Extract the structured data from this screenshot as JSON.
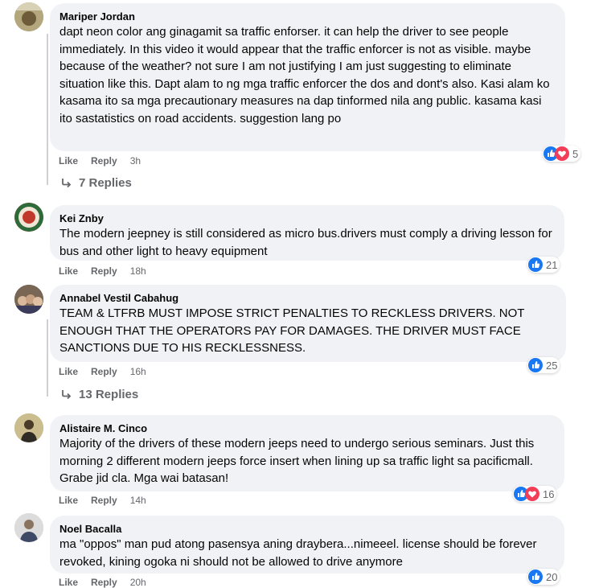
{
  "comments": [
    {
      "author": "Mariper Jordan",
      "text": "dapt neon color ang ginagamit sa traffic enforser. it can help the driver to see people immediately. In this video it would appear that the traffic enforcer is not as visible. maybe because of the weather? not sure I am not justifying I am just suggesting to eliminate situation like this. Dapt alam to ng mga traffic enforcer the dos and dont's also. Kasi alam ko kasama ito sa mga precautionary measures na dap tinformed nila ang public. kasama kasi ito sastatistics on road accidents. suggestion lang po",
      "like_label": "Like",
      "reply_label": "Reply",
      "time": "3h",
      "reaction_count": "5",
      "reactions": [
        "like-reaction-icon",
        "love-reaction-icon"
      ],
      "replies_label": "7 Replies"
    },
    {
      "author": "Kei Znby",
      "text": "The modern jeepney is still considered as micro bus.drivers must comply a driving lesson for bus and other light to heavy equipment",
      "like_label": "Like",
      "reply_label": "Reply",
      "time": "18h",
      "reaction_count": "21",
      "reactions": [
        "like-reaction-icon"
      ]
    },
    {
      "author": "Annabel Vestil Cabahug",
      "text": "TEAM & LTFRB MUST IMPOSE STRICT PENALTIES TO RECKLESS DRIVERS. NOT ENOUGH THAT THE OPERATORS PAY FOR DAMAGES. THE DRIVER MUST FACE SANCTIONS DUE TO HIS RECKLESSNESS.",
      "like_label": "Like",
      "reply_label": "Reply",
      "time": "16h",
      "reaction_count": "25",
      "reactions": [
        "like-reaction-icon"
      ],
      "replies_label": "13 Replies"
    },
    {
      "author": "Alistaire M. Cinco",
      "text": "Majority of the drivers of these modern jeeps need to undergo serious seminars. Just this morning 2 different modern jeeps force insert when lining up sa traffic light sa pacificmall. Grabe jid cla. Mga wai batasan!",
      "like_label": "Like",
      "reply_label": "Reply",
      "time": "14h",
      "reaction_count": "16",
      "reactions": [
        "like-reaction-icon",
        "love-reaction-icon"
      ]
    },
    {
      "author": "Noel Bacalla",
      "text": "ma \"oppos\" man pud atong pasensya aning draybera...nimeeel. license should be forever revoked, kining ogoka ni should not be allowed to drive anymore",
      "like_label": "Like",
      "reply_label": "Reply",
      "time": "20h",
      "reaction_count": "20",
      "reactions": [
        "like-reaction-icon"
      ]
    }
  ],
  "colors": {
    "bubble": "#f0f2f5",
    "meta": "#65676b",
    "like_blue": "#1877f2",
    "love_red": "#f33e58"
  }
}
